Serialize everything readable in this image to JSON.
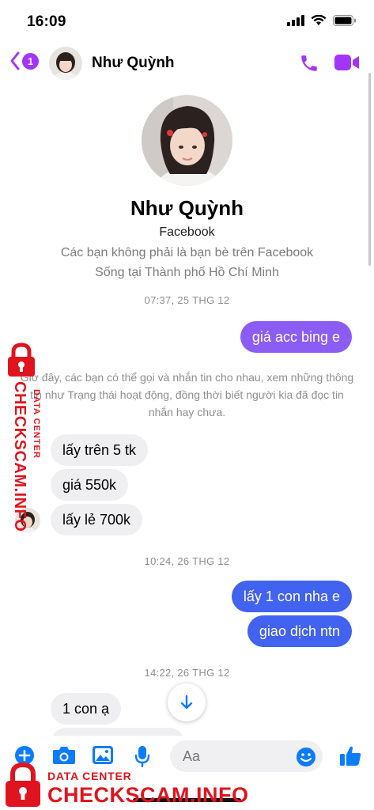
{
  "status_bar": {
    "time": "16:09"
  },
  "header": {
    "back_badge": "1",
    "contact_name": "Như Quỳnh",
    "icons": [
      "back-chevron-icon",
      "phone-icon",
      "video-camera-icon"
    ]
  },
  "profile": {
    "name": "Như Quỳnh",
    "source": "Facebook",
    "relation": "Các bạn không phải là bạn bè trên Facebook",
    "location": "Sống tại Thành phố Hồ Chí Minh"
  },
  "conversation": {
    "timestamps": [
      "07:37, 25 THG 12",
      "10:24, 26 THG 12",
      "14:22, 26 THG 12"
    ],
    "notice": "Giờ đây, các bạn có thể gọi và nhắn tin cho nhau, xem những thông tin như Trạng thái hoạt động, đồng thời biết người kia đã đọc tin nhắn hay chưa.",
    "messages": [
      {
        "from": "me",
        "text": "giá acc bing e"
      },
      {
        "from": "them",
        "text": "lấy trên 5 tk"
      },
      {
        "from": "them",
        "text": "giá 550k"
      },
      {
        "from": "them",
        "text": "lấy lẻ 700k"
      },
      {
        "from": "me",
        "text": "lấy 1 con nha e"
      },
      {
        "from": "me",
        "text": "giao dịch ntn"
      },
      {
        "from": "them",
        "text": "1 con ạ"
      }
    ]
  },
  "composer": {
    "placeholder": "Aa",
    "icons": [
      "plus-icon",
      "camera-icon",
      "image-icon",
      "microphone-icon",
      "emoji-icon",
      "thumbs-up-icon"
    ]
  },
  "watermark": {
    "sub": "DATA CENTER",
    "main": "CHECKSCAM.INFO"
  },
  "colors": {
    "accent_purple": "#a334fa",
    "bubble_purple": "#8b5cf6",
    "bubble_blue": "#4262f0",
    "icon_blue": "#0a7cff",
    "watermark_red": "#e0141e"
  }
}
